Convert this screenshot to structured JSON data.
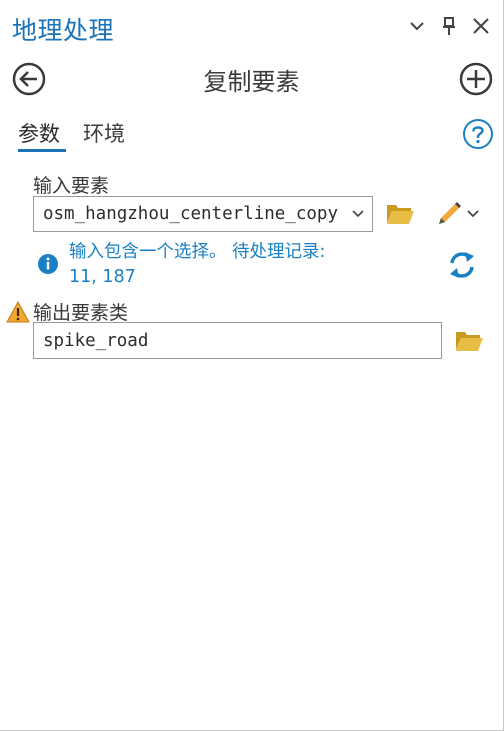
{
  "pane": {
    "title": "地理处理"
  },
  "tool": {
    "title": "复制要素"
  },
  "tabs": [
    {
      "label": "参数",
      "active": true
    },
    {
      "label": "环境",
      "active": false
    }
  ],
  "params": {
    "input": {
      "label": "输入要素",
      "value": "osm_hangzhou_centerline_copy",
      "info_line1": "输入包含一个选择。 待处理记录:",
      "info_line2": "11, 187"
    },
    "output": {
      "label": "输出要素类",
      "value": "spike_road",
      "warning": true
    }
  },
  "colors": {
    "accent": "#1a73b8",
    "info_text": "#1a80c4",
    "folder": "#e3b63b",
    "warning": "#f0a830"
  },
  "icons": {
    "back": "arrow-left-circle-icon",
    "add": "plus-circle-icon",
    "help": "question-circle-icon",
    "browse": "folder-open-icon",
    "edit": "pencil-icon",
    "refresh": "refresh-icon",
    "info": "info-icon",
    "warn": "warning-icon"
  }
}
